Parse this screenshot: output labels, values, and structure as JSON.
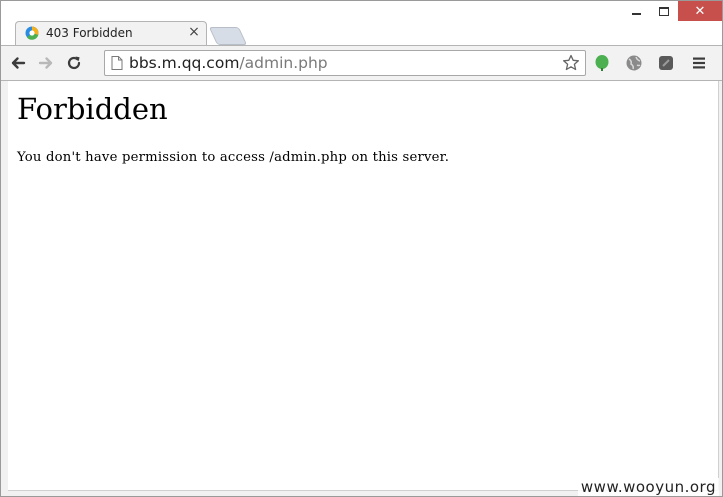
{
  "tab": {
    "title": "403 Forbidden",
    "close_glyph": "×",
    "favicon": "qq-browser-favicon"
  },
  "window_controls": {
    "minimize": "minimize-icon",
    "maximize": "maximize-icon",
    "close": "✕"
  },
  "toolbar": {
    "back": "back-arrow-icon",
    "forward": "forward-arrow-icon",
    "reload": "reload-icon",
    "extensions": [
      "green-leaf-extension-icon",
      "globe-extension-icon",
      "dark-square-extension-icon"
    ],
    "menu": "hamburger-menu-icon"
  },
  "address_bar": {
    "host": "bbs.m.qq.com",
    "path": "/admin.php"
  },
  "page": {
    "heading": "Forbidden",
    "message": "You don't have permission to access /admin.php on this server."
  },
  "watermark": "www.wooyun.org",
  "colors": {
    "close_button": "#c7504d",
    "leaf_extension": "#4caf50",
    "url_path": "#7a7a7a"
  }
}
